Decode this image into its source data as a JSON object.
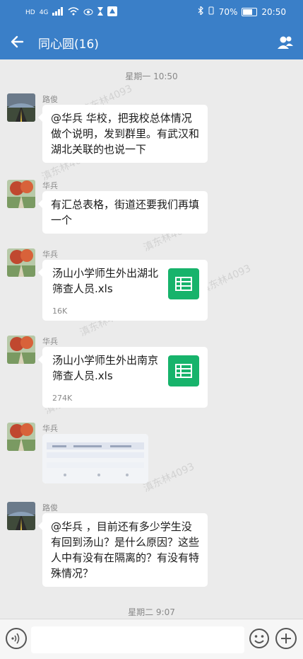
{
  "status_bar": {
    "left_chips": [
      "HD",
      "4G"
    ],
    "battery_text": "70%",
    "battery_level": 0.7,
    "clock": "20:50"
  },
  "header": {
    "title": "同心圆(16)",
    "back_icon": "arrow-left-icon",
    "group_icon": "people-icon"
  },
  "timestamps": [
    "星期一 10:50",
    "星期二 9:07"
  ],
  "watermark": "滇东林4093",
  "messages": [
    {
      "sender": "路俊",
      "type": "text",
      "text": "@华兵 华校，把我校总体情况做个说明，发到群里。有武汉和湖北关联的也说一下"
    },
    {
      "sender": "华兵",
      "type": "text",
      "text": "有汇总表格，街道还要我们再填一个"
    },
    {
      "sender": "华兵",
      "type": "file",
      "file_name": "汤山小学师生外出湖北筛查人员.xls",
      "file_size": "16K",
      "icon": "spreadsheet-icon",
      "icon_color": "#17b36b"
    },
    {
      "sender": "华兵",
      "type": "file",
      "file_name": "汤山小学师生外出南京筛查人员.xls",
      "file_size": "274K",
      "icon": "spreadsheet-icon",
      "icon_color": "#17b36b"
    },
    {
      "sender": "华兵",
      "type": "image",
      "description_label": "blurred-screenshot"
    },
    {
      "sender": "路俊",
      "type": "text",
      "text": "@华兵 ，目前还有多少学生没有回到汤山？是什么原因？这些人中有没有在隔离的？有没有特殊情况？"
    }
  ],
  "colors": {
    "header_blue": "#3a7fc8",
    "chat_bg": "#ebebeb",
    "xls_green": "#17b36b"
  }
}
